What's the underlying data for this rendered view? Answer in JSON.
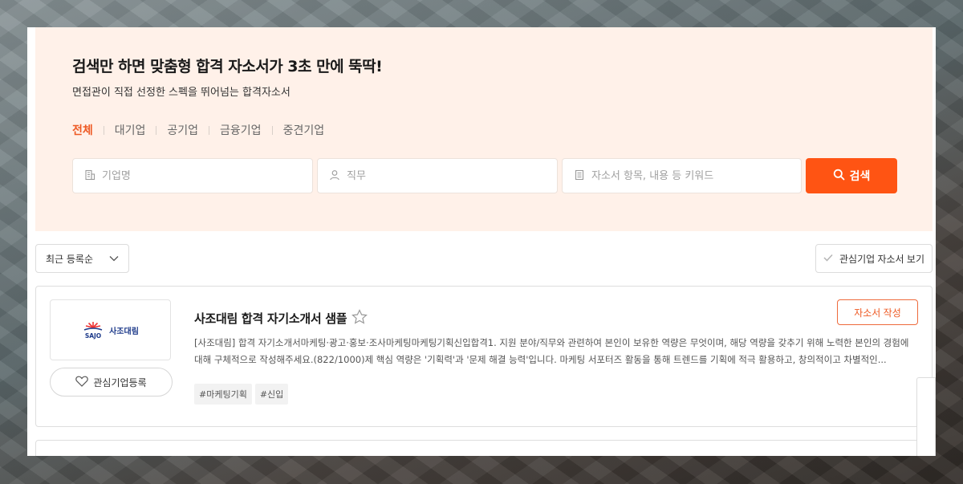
{
  "hero": {
    "title": "검색만 하면 맞춤형 합격 자소서가 3초 만에 뚝딱!",
    "subtitle": "면접관이 직접 선정한 스펙을 뛰어넘는 합격자소서"
  },
  "tabs": [
    {
      "label": "전체",
      "active": true
    },
    {
      "label": "대기업"
    },
    {
      "label": "공기업"
    },
    {
      "label": "금융기업"
    },
    {
      "label": "중견기업"
    }
  ],
  "search": {
    "company_placeholder": "기업명",
    "job_placeholder": "직무",
    "keyword_placeholder": "자소서 항목, 내용 등 키워드",
    "button_label": "검색"
  },
  "toolbar": {
    "sort_value": "최근 등록순",
    "interest_label": "관심기업 자소서 보기"
  },
  "cards": [
    {
      "company_logo_text": "사조대림",
      "company_logo_mark": "SAJO",
      "fav_label": "관심기업등록",
      "title": "사조대림 합격 자기소개서 샘플",
      "write_label": "자소서 작성",
      "description": "[사조대림] 합격 자기소개서마케팅·광고·홍보·조사마케팅마케팅기획신입합격1. 지원 분야/직무와 관련하여 본인이 보유한 역량은 무엇이며, 해당 역량을 갖추기 위해 노력한 본인의 경험에 대해 구체적으로 작성해주세요.(822/1000)제 핵심 역량은 '기획력'과 '문제 해결 능력'입니다. 마케팅 서포터즈 활동을 통해 트렌드를 기획에 적극 활용하고, 창의적이고 차별적인...",
      "tags": [
        "#마케팅기획",
        "#신입"
      ]
    }
  ],
  "colors": {
    "accent": "#ff5413",
    "hero_bg": "#fff1e9",
    "tab_active": "#ee5a24"
  },
  "icons": {
    "company": "building-icon",
    "job": "person-icon",
    "keyword": "document-icon",
    "search": "search-icon",
    "sort": "chevron-down-icon",
    "interest": "check-icon",
    "fav": "heart-icon",
    "star": "star-icon"
  }
}
